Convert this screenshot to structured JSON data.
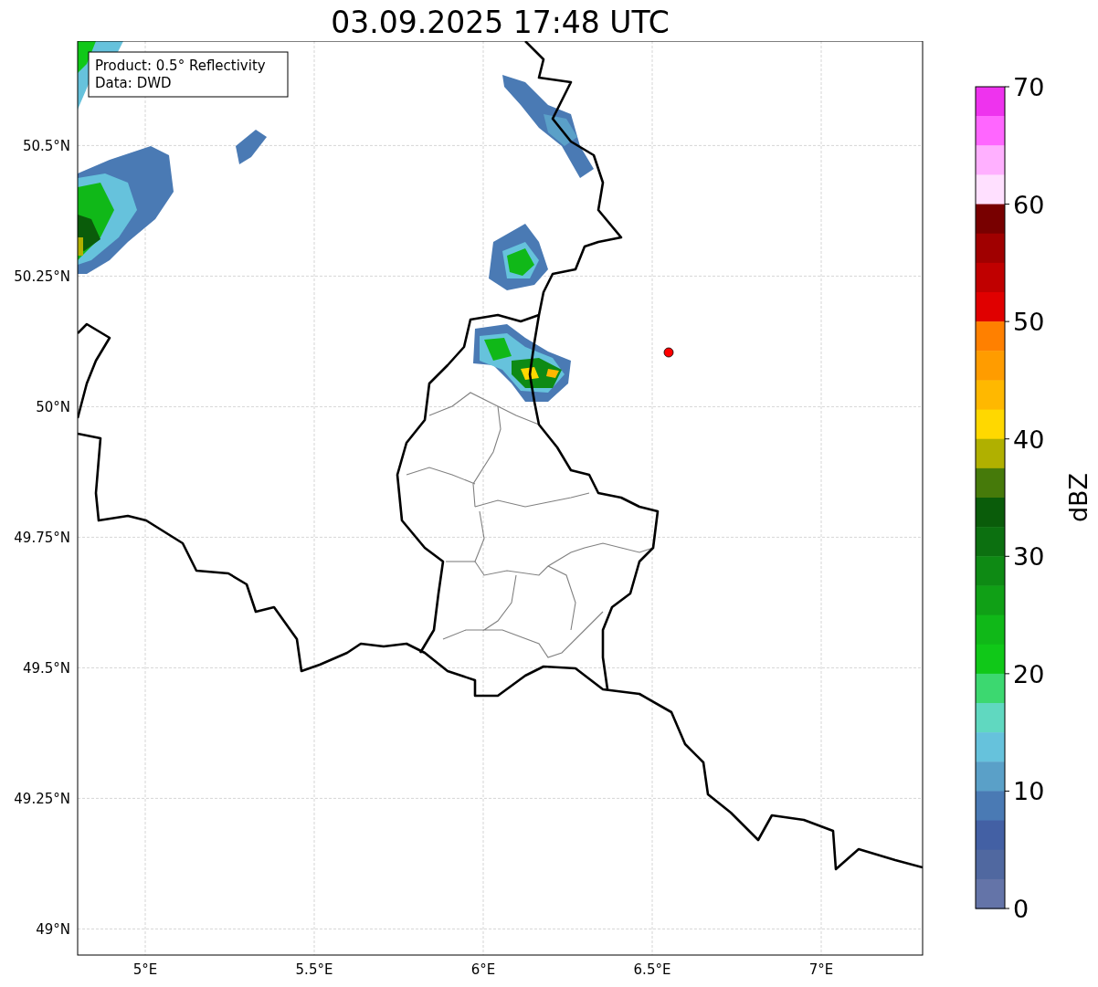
{
  "title": "03.09.2025 17:48 UTC",
  "map": {
    "info_box": [
      "Product: 0.5° Reflectivity",
      "Data: DWD"
    ],
    "lat_ticks": [
      "50.5°N",
      "50.25°N",
      "50°N",
      "49.75°N",
      "49.5°N",
      "49.25°N",
      "49°N"
    ],
    "lon_ticks": [
      "5°E",
      "5.5°E",
      "6°E",
      "6.5°E",
      "7°E"
    ]
  },
  "colorbar": {
    "label": "dBZ",
    "ticks": [
      "70",
      "60",
      "50",
      "40",
      "30",
      "20",
      "10",
      "0"
    ],
    "bins": [
      {
        "color": "#ee33ee"
      },
      {
        "color": "#ff66ff"
      },
      {
        "color": "#ffb0ff"
      },
      {
        "color": "#ffe0ff"
      },
      {
        "color": "#780000"
      },
      {
        "color": "#a00000"
      },
      {
        "color": "#c00000"
      },
      {
        "color": "#e00000"
      },
      {
        "color": "#ff8000"
      },
      {
        "color": "#ff9c00"
      },
      {
        "color": "#ffb800"
      },
      {
        "color": "#ffd800"
      },
      {
        "color": "#b0b000"
      },
      {
        "color": "#467a0a"
      },
      {
        "color": "#0a5c0a"
      },
      {
        "color": "#0c7010"
      },
      {
        "color": "#0e8a14"
      },
      {
        "color": "#10a016"
      },
      {
        "color": "#10b818"
      },
      {
        "color": "#10c818"
      },
      {
        "color": "#3cd870"
      },
      {
        "color": "#60d8c0"
      },
      {
        "color": "#66c2dc"
      },
      {
        "color": "#5aa0c8"
      },
      {
        "color": "#4a7ab4"
      },
      {
        "color": "#4360a4"
      },
      {
        "color": "#5068a0"
      },
      {
        "color": "#6474a8"
      }
    ]
  }
}
